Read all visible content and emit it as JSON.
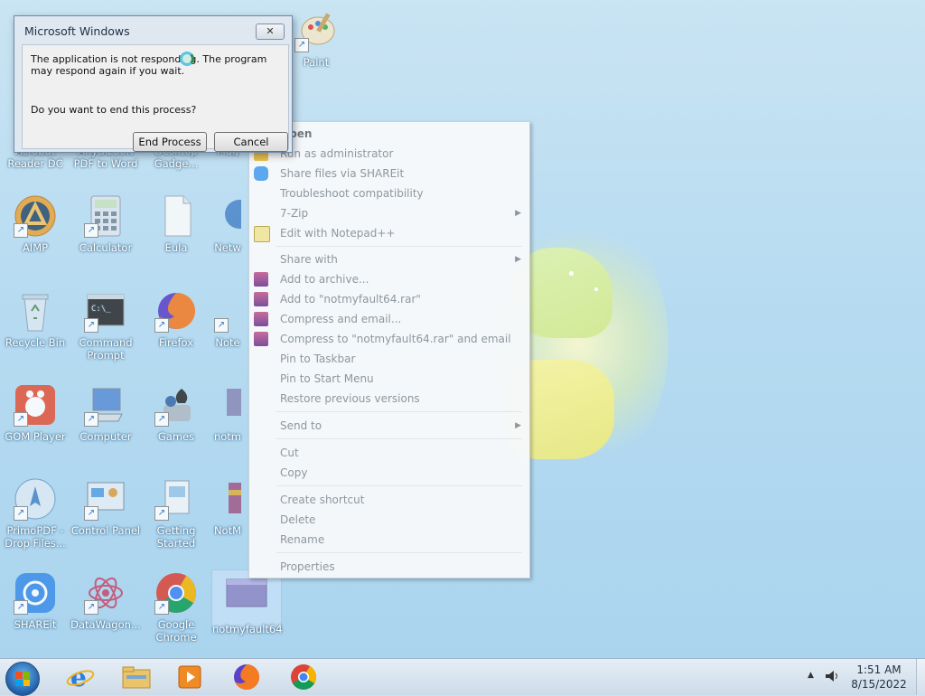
{
  "desktop": {
    "icons": [
      {
        "label": "Paint"
      },
      {
        "label": "Acrobat Reader DC"
      },
      {
        "label": "AnyBizSoft PDF to Word"
      },
      {
        "label": "Desktop Gadge..."
      },
      {
        "label": "Mag"
      },
      {
        "label": "AIMP"
      },
      {
        "label": "Calculator"
      },
      {
        "label": "Eula"
      },
      {
        "label": "Netw"
      },
      {
        "label": "Recycle Bin"
      },
      {
        "label": "Command Prompt"
      },
      {
        "label": "Firefox"
      },
      {
        "label": "Note"
      },
      {
        "label": "GOM Player"
      },
      {
        "label": "Computer"
      },
      {
        "label": "Games"
      },
      {
        "label": "notm"
      },
      {
        "label": "PrimoPDF - Drop Files..."
      },
      {
        "label": "Control Panel"
      },
      {
        "label": "Getting Started"
      },
      {
        "label": "NotM"
      },
      {
        "label": "SHAREit"
      },
      {
        "label": "DataWagon..."
      },
      {
        "label": "Google Chrome"
      },
      {
        "label": "notmyfault64"
      }
    ]
  },
  "context_menu": {
    "items": [
      {
        "label": "Open"
      },
      {
        "label": "Run as administrator"
      },
      {
        "label": "Share files via SHAREit"
      },
      {
        "label": "Troubleshoot compatibility"
      },
      {
        "label": "7-Zip"
      },
      {
        "label": "Edit with Notepad++"
      },
      {
        "label": "Share with"
      },
      {
        "label": "Add to archive..."
      },
      {
        "label": "Add to \"notmyfault64.rar\""
      },
      {
        "label": "Compress and email..."
      },
      {
        "label": "Compress to \"notmyfault64.rar\" and email"
      },
      {
        "label": "Pin to Taskbar"
      },
      {
        "label": "Pin to Start Menu"
      },
      {
        "label": "Restore previous versions"
      },
      {
        "label": "Send to"
      },
      {
        "label": "Cut"
      },
      {
        "label": "Copy"
      },
      {
        "label": "Create shortcut"
      },
      {
        "label": "Delete"
      },
      {
        "label": "Rename"
      },
      {
        "label": "Properties"
      }
    ]
  },
  "dialog": {
    "title": "Microsoft Windows",
    "close_glyph": "✕",
    "message": "The application is not responding. The program may respond again if you wait.",
    "question": "Do you want to end this process?",
    "end_button": "End Process",
    "cancel_button": "Cancel"
  },
  "taskbar": {
    "time": "1:51 AM",
    "date": "8/15/2022",
    "tray_arrow": "▲",
    "apps": [
      "internet-explorer-icon",
      "file-explorer-icon",
      "media-player-icon",
      "firefox-icon",
      "chrome-icon"
    ]
  },
  "colors": {
    "desktop_bg": "#b6dbf1",
    "menu_text_disabled": "#8d959c",
    "dialog_bg": "#dfe8f1"
  }
}
